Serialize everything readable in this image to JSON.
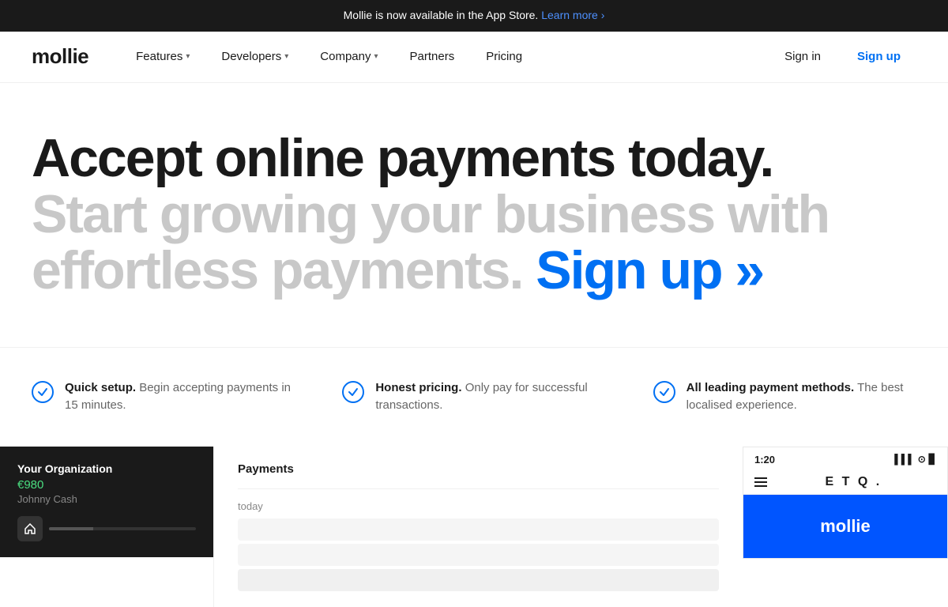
{
  "announcement": {
    "text": "Mollie is now available in the App Store.",
    "link_text": "Learn more ›",
    "link_url": "#"
  },
  "navbar": {
    "logo": "mollie",
    "nav_items": [
      {
        "label": "Features",
        "has_dropdown": true
      },
      {
        "label": "Developers",
        "has_dropdown": true
      },
      {
        "label": "Company",
        "has_dropdown": true
      },
      {
        "label": "Partners",
        "has_dropdown": false
      }
    ],
    "pricing_label": "Pricing",
    "sign_in_label": "Sign in",
    "sign_up_label": "Sign up"
  },
  "hero": {
    "title": "Accept online payments today.",
    "subtitle_part1": "Start growing your business with",
    "subtitle_part2": "effortless payments.",
    "signup_cta": "Sign up »"
  },
  "features": [
    {
      "id": "quick-setup",
      "title": "Quick setup.",
      "description": "Begin accepting payments in 15 minutes."
    },
    {
      "id": "honest-pricing",
      "title": "Honest pricing.",
      "description": "Only pay for successful transactions."
    },
    {
      "id": "payment-methods",
      "title": "All leading payment methods.",
      "description": "The best localised experience."
    }
  ],
  "dashboard": {
    "org_label": "Your Organization",
    "amount": "€980",
    "user": "Johnny Cash"
  },
  "payments_section": {
    "title": "Payments",
    "today_label": "today"
  },
  "phone_mockup": {
    "time": "1:20",
    "brand": "E T Q .",
    "mollie_label": "mollie"
  }
}
